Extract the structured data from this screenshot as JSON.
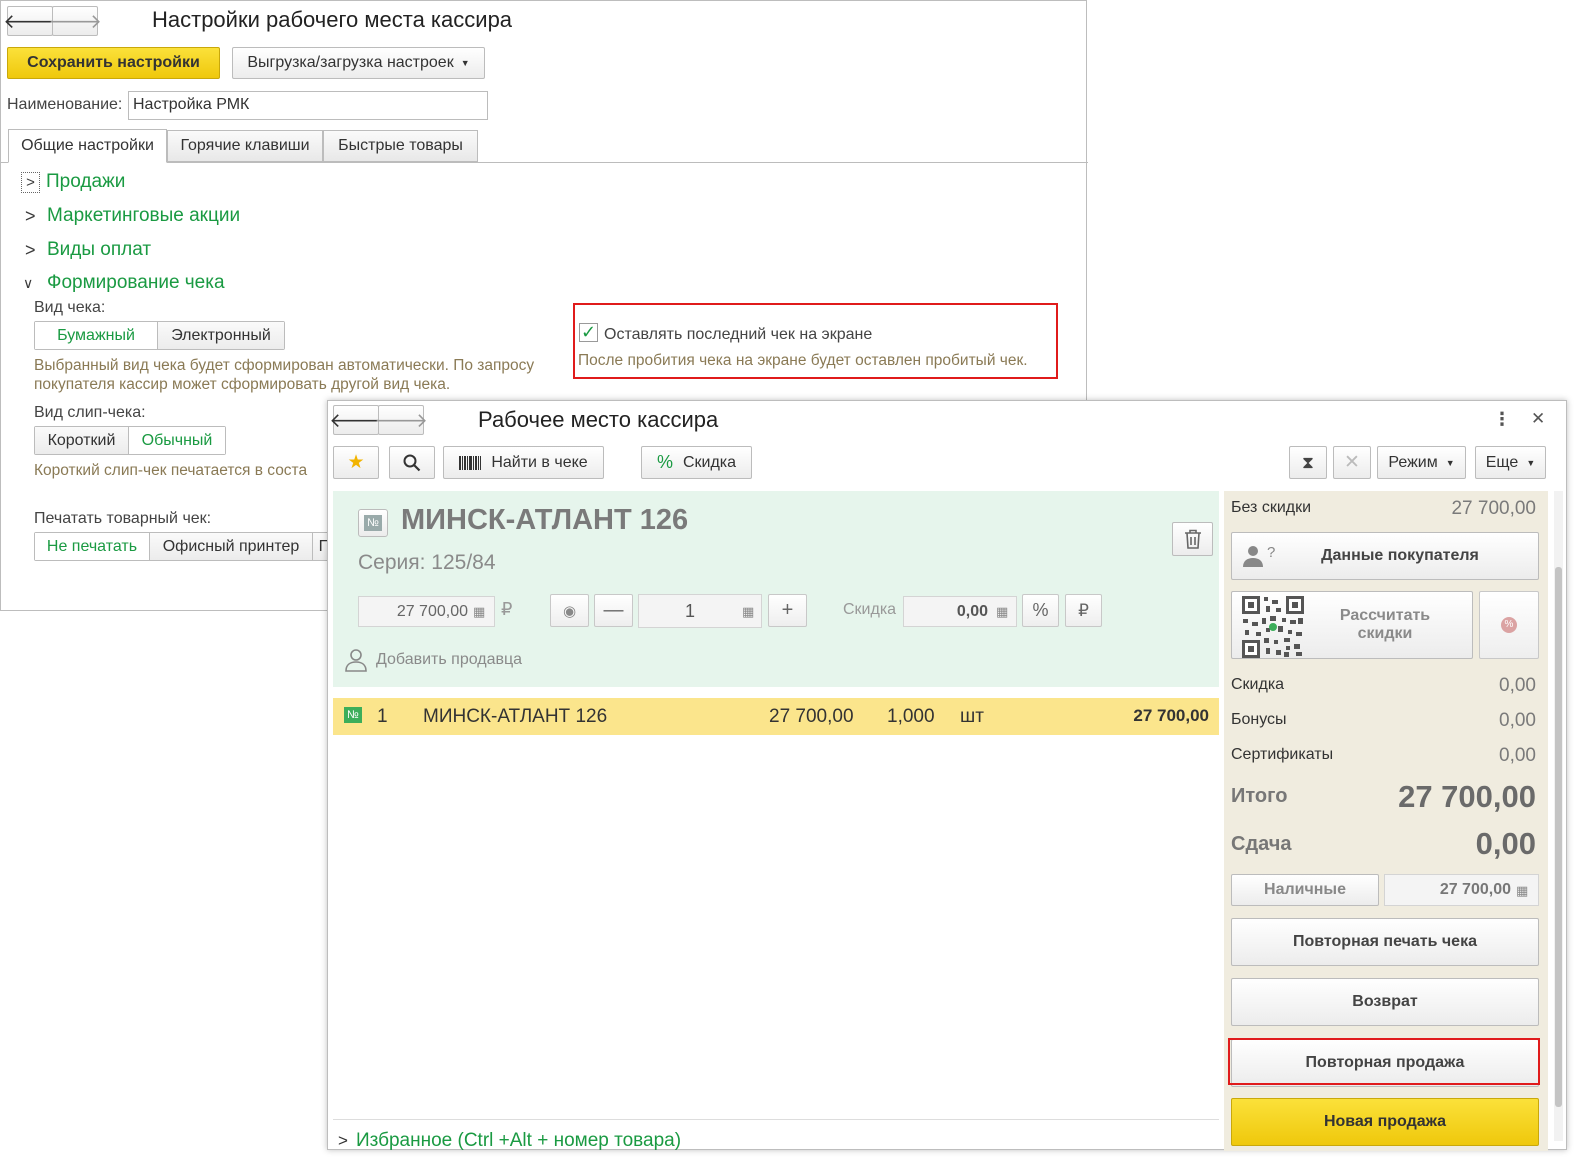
{
  "settings": {
    "title": "Настройки рабочего места кассира",
    "save_label": "Сохранить настройки",
    "export_label": "Выгрузка/загрузка настроек",
    "name_label": "Наименование:",
    "name_value": "Настройка РМК",
    "tabs": [
      "Общие настройки",
      "Горячие клавиши",
      "Быстрые товары"
    ],
    "sections": [
      "Продажи",
      "Маркетинговые акции",
      "Виды оплат",
      "Формирование чека"
    ],
    "receipt_type_label": "Вид чека:",
    "receipt_type_options": [
      "Бумажный",
      "Электронный"
    ],
    "receipt_type_hint_1": "Выбранный вид чека будет сформирован автоматически. По запросу",
    "receipt_type_hint_2": "покупателя кассир может сформировать другой вид чека.",
    "keep_last_label": "Оставлять последний чек на экране",
    "keep_last_hint": "После пробития чека на экране будет оставлен пробитый чек.",
    "slip_label": "Вид слип-чека:",
    "slip_options": [
      "Короткий",
      "Обычный"
    ],
    "slip_hint": "Короткий слип-чек печатается  в соста",
    "print_label": "Печатать товарный чек:",
    "print_options": [
      "Не печатать",
      "Офисный принтер",
      "Г"
    ]
  },
  "cashier": {
    "title": "Рабочее место кассира",
    "find_label": "Найти в чеке",
    "discount_btn_label": "Скидка",
    "mode_label": "Режим",
    "more_label": "Еще",
    "product": {
      "name": "МИНСК-АТЛАНТ 126",
      "series": "Серия: 125/84",
      "price": "27 700,00",
      "currency": "₽",
      "qty": "1",
      "discount_label": "Скидка",
      "discount_value": "0,00",
      "add_seller": "Добавить продавца"
    },
    "row": {
      "num": "1",
      "name": "МИНСК-АТЛАНТ 126",
      "price": "27 700,00",
      "qty": "1,000",
      "unit": "шт",
      "sum": "27 700,00"
    },
    "favorites": "Избранное (Ctrl +Alt + номер товара)",
    "right": {
      "no_discount_label": "Без скидки",
      "no_discount_value": "27 700,00",
      "buyer_data": "Данные покупателя",
      "calc_discount_1": "Рассчитать",
      "calc_discount_2": "скидки",
      "discount_label": "Скидка",
      "discount_value": "0,00",
      "bonuses_label": "Бонусы",
      "bonuses_value": "0,00",
      "certs_label": "Сертификаты",
      "certs_value": "0,00",
      "total_label": "Итого",
      "total_value": "27 700,00",
      "change_label": "Сдача",
      "change_value": "0,00",
      "cash_label": "Наличные",
      "cash_value": "27 700,00",
      "reprint": "Повторная печать чека",
      "return": "Возврат",
      "repeat_sale": "Повторная продажа",
      "new_sale": "Новая продажа"
    }
  },
  "colors": {
    "accent_green": "#1a9a42",
    "highlight_red": "#e01b1b",
    "yellow": "#f5d21a",
    "row_yellow": "#fbe58c",
    "mint": "#e6f5ec",
    "panel_beige": "#f0ecdf"
  }
}
